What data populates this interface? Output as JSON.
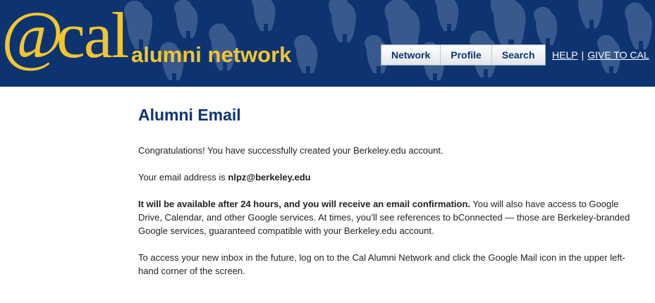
{
  "brand": {
    "at": "@",
    "cal": "cal",
    "network": "alumni network",
    "color_gold": "#f2c530",
    "color_navy": "#0d3470"
  },
  "nav": {
    "items": [
      {
        "label": "Network"
      },
      {
        "label": "Profile"
      },
      {
        "label": "Search"
      }
    ]
  },
  "toplinks": {
    "help": "HELP",
    "separator": "|",
    "give": "GIVE TO CAL"
  },
  "main": {
    "title": "Alumni Email",
    "congrats": "Congratulations! You have successfully created your Berkeley.edu account.",
    "email_prefix": "Your email address is ",
    "email": "nlpz@berkeley.edu",
    "availability_bold": "It will be available after 24 hours, and you will receive an email confirmation.",
    "availability_rest": " You will also have access to Google Drive, Calendar, and other Google services. At times, you’ll see references to bConnected — those are Berkeley-branded Google services, guaranteed compatible with your Berkeley.edu account.",
    "access_info": "To access your new inbox in the future, log on to the Cal Alumni Network and click the Google Mail icon in the upper left-hand corner of the screen."
  }
}
